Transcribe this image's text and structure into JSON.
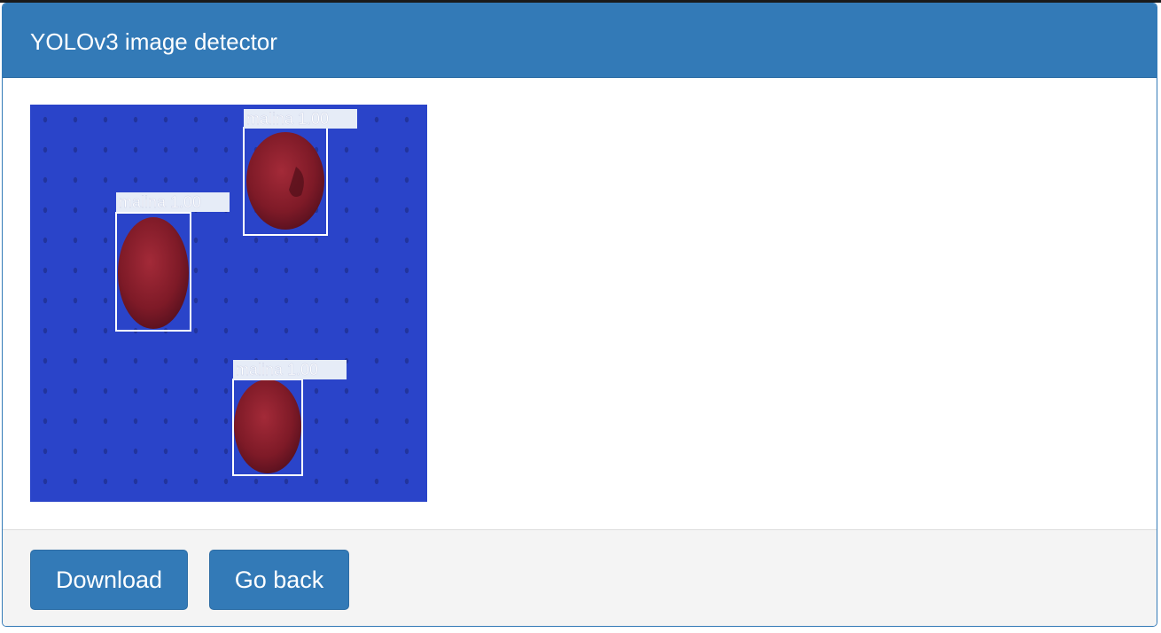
{
  "panel": {
    "title": "YOLOv3 image detector"
  },
  "result_image": {
    "background_color": "#2a44c9",
    "detections": [
      {
        "label": "malina",
        "score": "1.00",
        "label_text": "malina  1.00"
      },
      {
        "label": "malina",
        "score": "1.00",
        "label_text": "malina  1.00"
      },
      {
        "label": "malina",
        "score": "1.00",
        "label_text": "malina  1.00"
      }
    ]
  },
  "footer": {
    "download_label": "Download",
    "back_label": "Go back"
  },
  "colors": {
    "primary": "#337ab7",
    "footer_bg": "#f4f4f4",
    "berry": "#8c1c2a"
  }
}
